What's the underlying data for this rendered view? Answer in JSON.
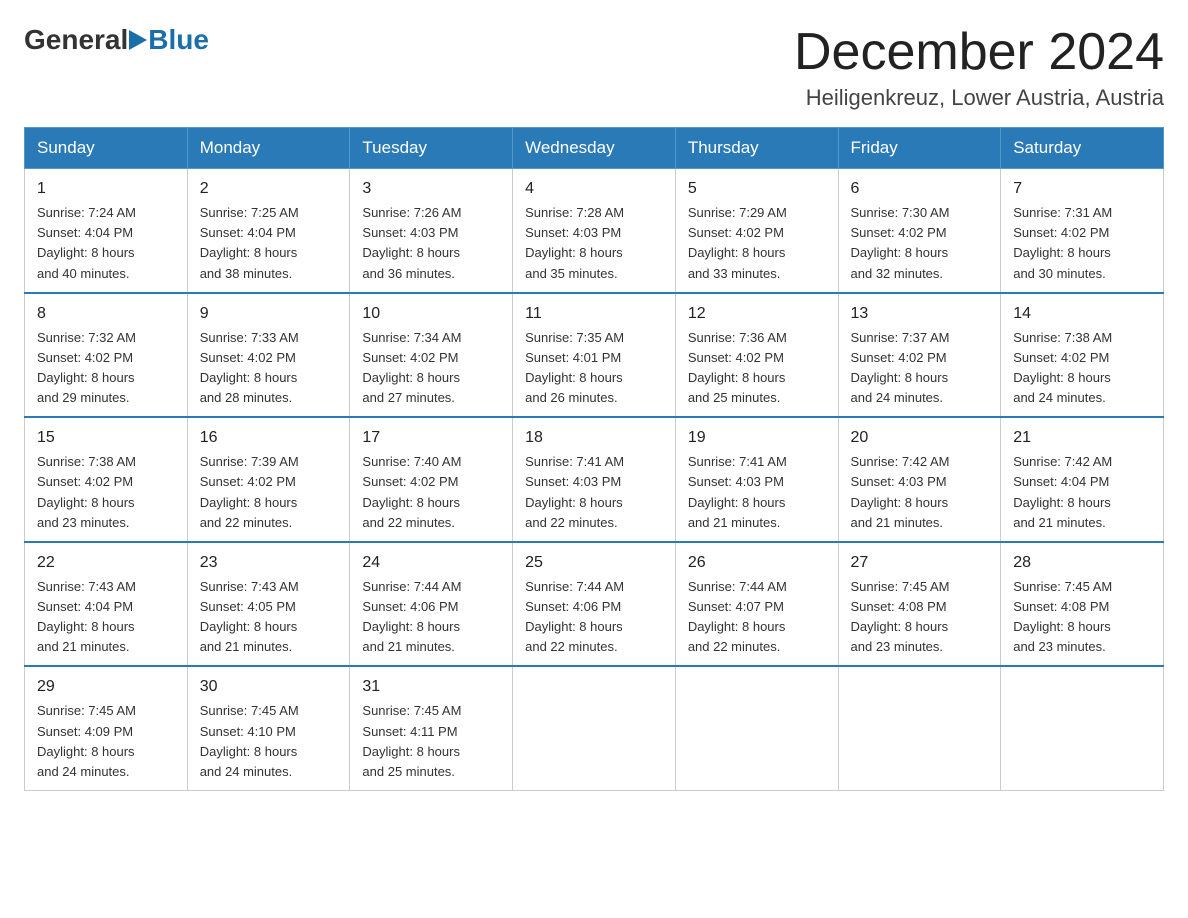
{
  "logo": {
    "text_general": "General",
    "triangle": "▶",
    "text_blue": "Blue"
  },
  "header": {
    "title": "December 2024",
    "subtitle": "Heiligenkreuz, Lower Austria, Austria"
  },
  "days_of_week": [
    "Sunday",
    "Monday",
    "Tuesday",
    "Wednesday",
    "Thursday",
    "Friday",
    "Saturday"
  ],
  "weeks": [
    [
      {
        "day": "1",
        "sunrise": "7:24 AM",
        "sunset": "4:04 PM",
        "daylight": "8 hours and 40 minutes."
      },
      {
        "day": "2",
        "sunrise": "7:25 AM",
        "sunset": "4:04 PM",
        "daylight": "8 hours and 38 minutes."
      },
      {
        "day": "3",
        "sunrise": "7:26 AM",
        "sunset": "4:03 PM",
        "daylight": "8 hours and 36 minutes."
      },
      {
        "day": "4",
        "sunrise": "7:28 AM",
        "sunset": "4:03 PM",
        "daylight": "8 hours and 35 minutes."
      },
      {
        "day": "5",
        "sunrise": "7:29 AM",
        "sunset": "4:02 PM",
        "daylight": "8 hours and 33 minutes."
      },
      {
        "day": "6",
        "sunrise": "7:30 AM",
        "sunset": "4:02 PM",
        "daylight": "8 hours and 32 minutes."
      },
      {
        "day": "7",
        "sunrise": "7:31 AM",
        "sunset": "4:02 PM",
        "daylight": "8 hours and 30 minutes."
      }
    ],
    [
      {
        "day": "8",
        "sunrise": "7:32 AM",
        "sunset": "4:02 PM",
        "daylight": "8 hours and 29 minutes."
      },
      {
        "day": "9",
        "sunrise": "7:33 AM",
        "sunset": "4:02 PM",
        "daylight": "8 hours and 28 minutes."
      },
      {
        "day": "10",
        "sunrise": "7:34 AM",
        "sunset": "4:02 PM",
        "daylight": "8 hours and 27 minutes."
      },
      {
        "day": "11",
        "sunrise": "7:35 AM",
        "sunset": "4:01 PM",
        "daylight": "8 hours and 26 minutes."
      },
      {
        "day": "12",
        "sunrise": "7:36 AM",
        "sunset": "4:02 PM",
        "daylight": "8 hours and 25 minutes."
      },
      {
        "day": "13",
        "sunrise": "7:37 AM",
        "sunset": "4:02 PM",
        "daylight": "8 hours and 24 minutes."
      },
      {
        "day": "14",
        "sunrise": "7:38 AM",
        "sunset": "4:02 PM",
        "daylight": "8 hours and 24 minutes."
      }
    ],
    [
      {
        "day": "15",
        "sunrise": "7:38 AM",
        "sunset": "4:02 PM",
        "daylight": "8 hours and 23 minutes."
      },
      {
        "day": "16",
        "sunrise": "7:39 AM",
        "sunset": "4:02 PM",
        "daylight": "8 hours and 22 minutes."
      },
      {
        "day": "17",
        "sunrise": "7:40 AM",
        "sunset": "4:02 PM",
        "daylight": "8 hours and 22 minutes."
      },
      {
        "day": "18",
        "sunrise": "7:41 AM",
        "sunset": "4:03 PM",
        "daylight": "8 hours and 22 minutes."
      },
      {
        "day": "19",
        "sunrise": "7:41 AM",
        "sunset": "4:03 PM",
        "daylight": "8 hours and 21 minutes."
      },
      {
        "day": "20",
        "sunrise": "7:42 AM",
        "sunset": "4:03 PM",
        "daylight": "8 hours and 21 minutes."
      },
      {
        "day": "21",
        "sunrise": "7:42 AM",
        "sunset": "4:04 PM",
        "daylight": "8 hours and 21 minutes."
      }
    ],
    [
      {
        "day": "22",
        "sunrise": "7:43 AM",
        "sunset": "4:04 PM",
        "daylight": "8 hours and 21 minutes."
      },
      {
        "day": "23",
        "sunrise": "7:43 AM",
        "sunset": "4:05 PM",
        "daylight": "8 hours and 21 minutes."
      },
      {
        "day": "24",
        "sunrise": "7:44 AM",
        "sunset": "4:06 PM",
        "daylight": "8 hours and 21 minutes."
      },
      {
        "day": "25",
        "sunrise": "7:44 AM",
        "sunset": "4:06 PM",
        "daylight": "8 hours and 22 minutes."
      },
      {
        "day": "26",
        "sunrise": "7:44 AM",
        "sunset": "4:07 PM",
        "daylight": "8 hours and 22 minutes."
      },
      {
        "day": "27",
        "sunrise": "7:45 AM",
        "sunset": "4:08 PM",
        "daylight": "8 hours and 23 minutes."
      },
      {
        "day": "28",
        "sunrise": "7:45 AM",
        "sunset": "4:08 PM",
        "daylight": "8 hours and 23 minutes."
      }
    ],
    [
      {
        "day": "29",
        "sunrise": "7:45 AM",
        "sunset": "4:09 PM",
        "daylight": "8 hours and 24 minutes."
      },
      {
        "day": "30",
        "sunrise": "7:45 AM",
        "sunset": "4:10 PM",
        "daylight": "8 hours and 24 minutes."
      },
      {
        "day": "31",
        "sunrise": "7:45 AM",
        "sunset": "4:11 PM",
        "daylight": "8 hours and 25 minutes."
      },
      null,
      null,
      null,
      null
    ]
  ],
  "labels": {
    "sunrise": "Sunrise:",
    "sunset": "Sunset:",
    "daylight": "Daylight:"
  }
}
